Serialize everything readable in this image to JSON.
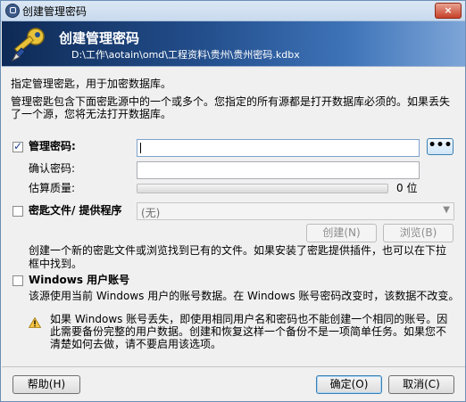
{
  "window": {
    "title": "创建管理密码",
    "close_label": "×"
  },
  "banner": {
    "title": "创建管理密码",
    "path": "D:\\工作\\aotain\\omd\\工程资料\\贵州\\贵州密码.kdbx"
  },
  "intro": {
    "line1": "指定管理密匙，用于加密数据库。",
    "line2": "管理密匙包含下面密匙源中的一个或多个。您指定的所有源都是打开数据库必须的。如果丢失",
    "line3": "了一个源，您将无法打开数据库。"
  },
  "master_password": {
    "label": "管理密码:",
    "checked": true,
    "value": "",
    "dots_label": "•••",
    "confirm_label": "确认密码:",
    "confirm_value": "",
    "quality_label": "估算质量:",
    "quality_value": "0 位",
    "quality_fraction": 0
  },
  "key_file": {
    "label": "密匙文件/ 提供程序",
    "checked": false,
    "selected": "(无)",
    "create_label": "创建(N)",
    "browse_label": "浏览(B)",
    "desc_line1": "创建一个新的密匙文件或浏览找到已有的文件。如果安装了密匙提供插件，也可以在下拉",
    "desc_line2": "框中找到。"
  },
  "windows_account": {
    "label": "Windows 用户账号",
    "checked": false,
    "desc": "该源使用当前 Windows 用户的账号数据。在 Windows 账号密码改变时，该数据不改变。",
    "warn_line1": "如果 Windows 账号丢失，即使用相同用户名和密码也不能创建一个相同的账号。因",
    "warn_line2": "此需要备份完整的用户数据。创建和恢复这样一个备份不是一项简单任务。如果您不",
    "warn_line3": "清楚如何去做，请不要启用该选项。"
  },
  "footer": {
    "help_label": "帮助(H)",
    "ok_label": "确定(O)",
    "cancel_label": "取消(C)"
  },
  "icons": {
    "title": "lock-icon",
    "banner": "key-icon",
    "warning": "warning-icon"
  },
  "colors": {
    "banner_dark": "#0e2a56",
    "banner_light": "#7ea6d8",
    "accent": "#3c7fb1"
  }
}
